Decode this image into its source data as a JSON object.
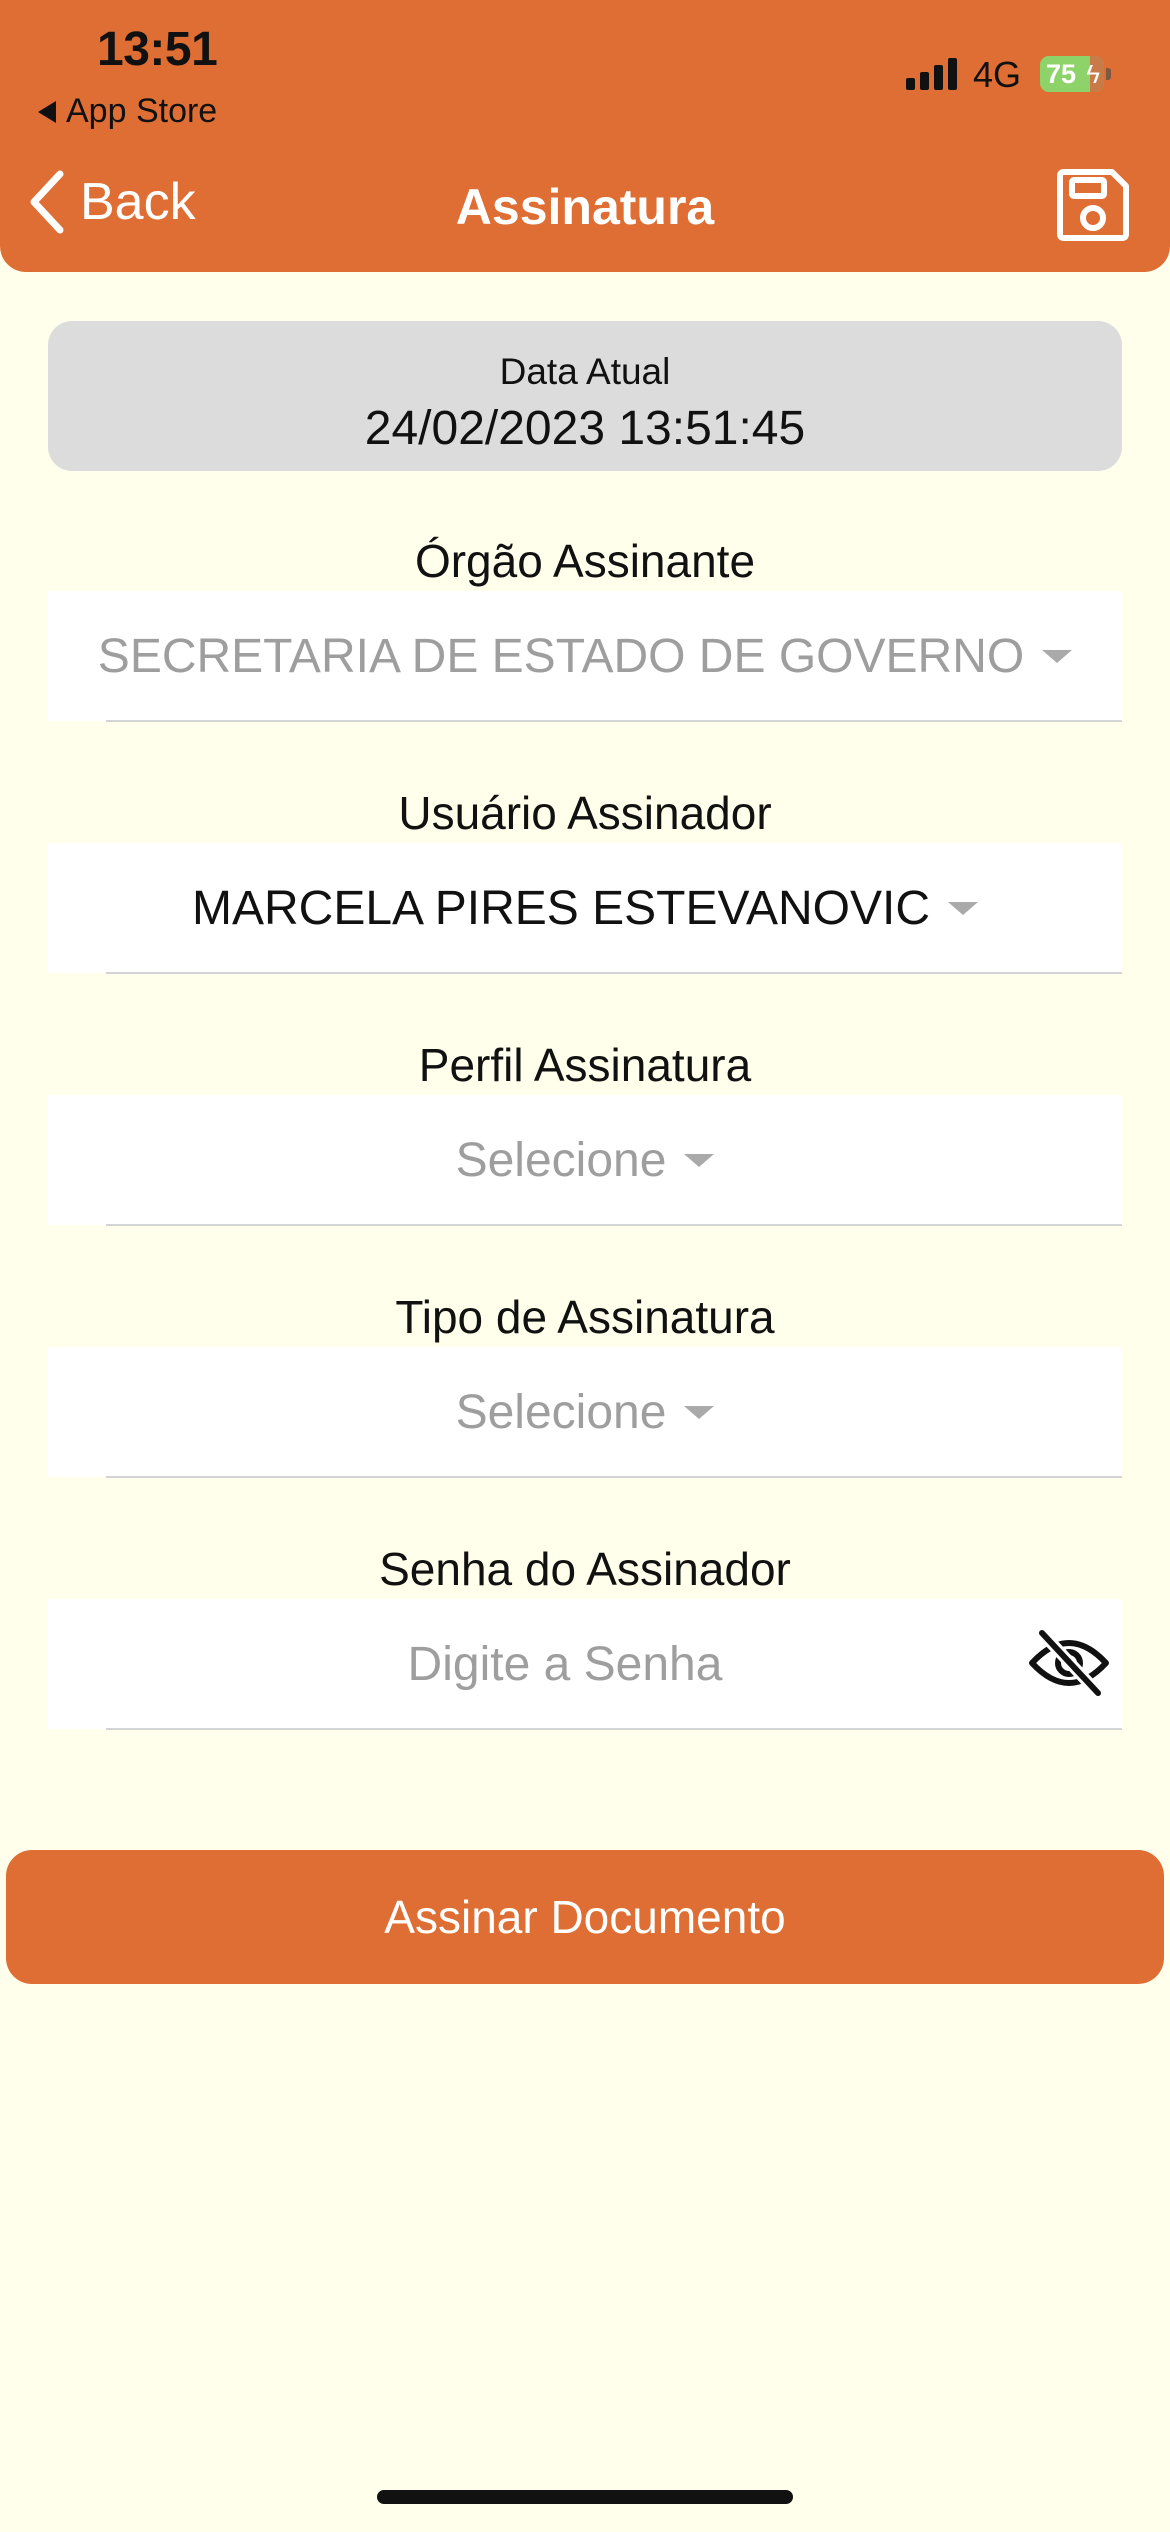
{
  "status_bar": {
    "time": "13:51",
    "back_app": "App Store",
    "network": "4G",
    "battery": "75"
  },
  "nav": {
    "back_label": "Back",
    "title": "Assinatura",
    "save_icon": "floppy-disk-icon"
  },
  "date_card": {
    "label": "Data Atual",
    "value": "24/02/2023 13:51:45"
  },
  "fields": {
    "orgao": {
      "label": "Órgão Assinante",
      "value": "SECRETARIA DE ESTADO DE GOVERNO"
    },
    "usuario": {
      "label": "Usuário Assinador",
      "value": "MARCELA PIRES ESTEVANOVIC"
    },
    "perfil": {
      "label": "Perfil Assinatura",
      "value": "Selecione"
    },
    "tipo": {
      "label": "Tipo de Assinatura",
      "value": "Selecione"
    },
    "senha": {
      "label": "Senha do Assinador",
      "placeholder": "Digite a Senha"
    }
  },
  "sign_button": "Assinar Documento",
  "colors": {
    "accent": "#DE6E33",
    "background": "#FFFFEC",
    "card": "#DCDCDC",
    "placeholder": "#9E9E9E"
  }
}
